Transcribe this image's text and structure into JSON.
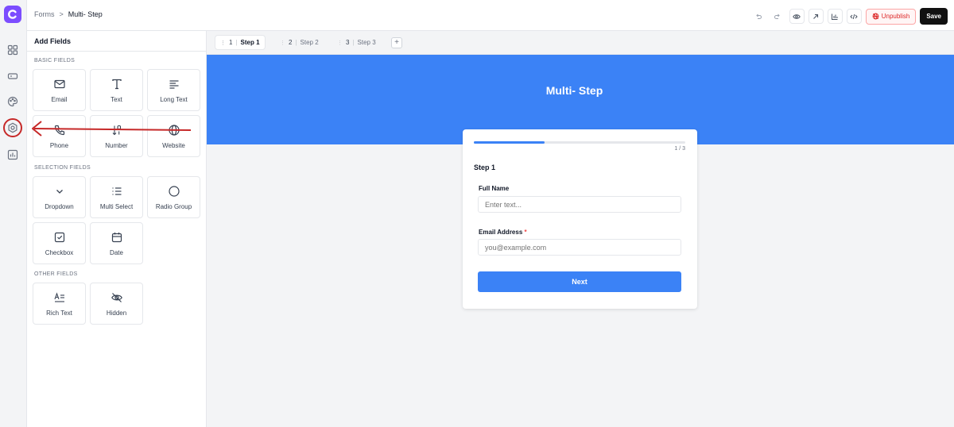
{
  "breadcrumb": {
    "parent": "Forms",
    "separator": ">",
    "current": "Multi- Step"
  },
  "toolbar": {
    "unpublish_label": "Unpublish",
    "save_label": "Save"
  },
  "panel": {
    "title": "Add Fields",
    "basic_title": "BASIC FIELDS",
    "basic": [
      "Email",
      "Text",
      "Long Text",
      "Phone",
      "Number",
      "Website"
    ],
    "selection_title": "SELECTION FIELDS",
    "selection": [
      "Dropdown",
      "Multi Select",
      "Radio Group",
      "Checkbox",
      "Date"
    ],
    "other_title": "OTHER FIELDS",
    "other": [
      "Rich Text",
      "Hidden"
    ]
  },
  "tabs": [
    {
      "num": "1",
      "label": "Step 1",
      "active": true
    },
    {
      "num": "2",
      "label": "Step 2",
      "active": false
    },
    {
      "num": "3",
      "label": "Step 3",
      "active": false
    }
  ],
  "tab_add": "+",
  "form": {
    "title": "Multi- Step",
    "progress": {
      "current": 1,
      "total": 3,
      "label": "1 / 3"
    },
    "step_title": "Step 1",
    "fields": [
      {
        "label": "Full Name",
        "placeholder": "Enter text...",
        "required": false
      },
      {
        "label": "Email Address",
        "placeholder": "you@example.com",
        "required": true,
        "required_mark": "*"
      }
    ],
    "next_label": "Next"
  },
  "colors": {
    "brand": "#7c4dff",
    "accent": "#3b82f6",
    "danger": "#dc2626",
    "annotation": "#c62828"
  }
}
